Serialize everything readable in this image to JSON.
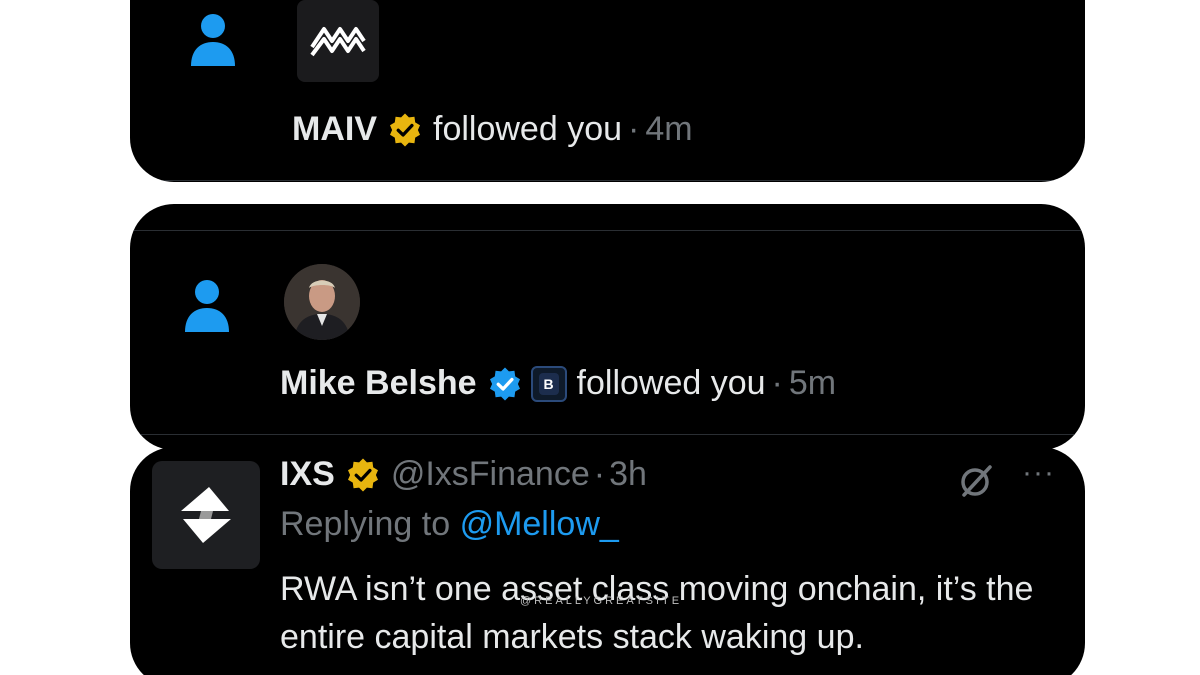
{
  "notifications": [
    {
      "name": "MAIV",
      "action": "followed you",
      "separator": "·",
      "time": "4m",
      "verified": "gold",
      "icon": "person-icon",
      "avatar": "maiv-logo"
    },
    {
      "name": "Mike Belshe",
      "action": "followed you",
      "separator": "·",
      "time": "5m",
      "verified": "blue",
      "affiliate_badge": "B",
      "icon": "person-icon",
      "avatar": "mike-belshe-avatar"
    }
  ],
  "tweet": {
    "name": "IXS",
    "handle": "@IxsFinance",
    "separator": "·",
    "time": "3h",
    "verified": "gold",
    "replying_prefix": "Replying to",
    "replying_mention": "@Mellow_",
    "text": "RWA isn’t one asset class moving onchain, it’s the entire capital markets stack waking up.",
    "more_label": "···"
  },
  "watermark": "@REALLYGREATSITE",
  "colors": {
    "background": "#000000",
    "accent_blue": "#1d9bf0",
    "gold_badge": "#e8b50f",
    "muted_text": "#71767b",
    "primary_text": "#e7e9ea"
  }
}
